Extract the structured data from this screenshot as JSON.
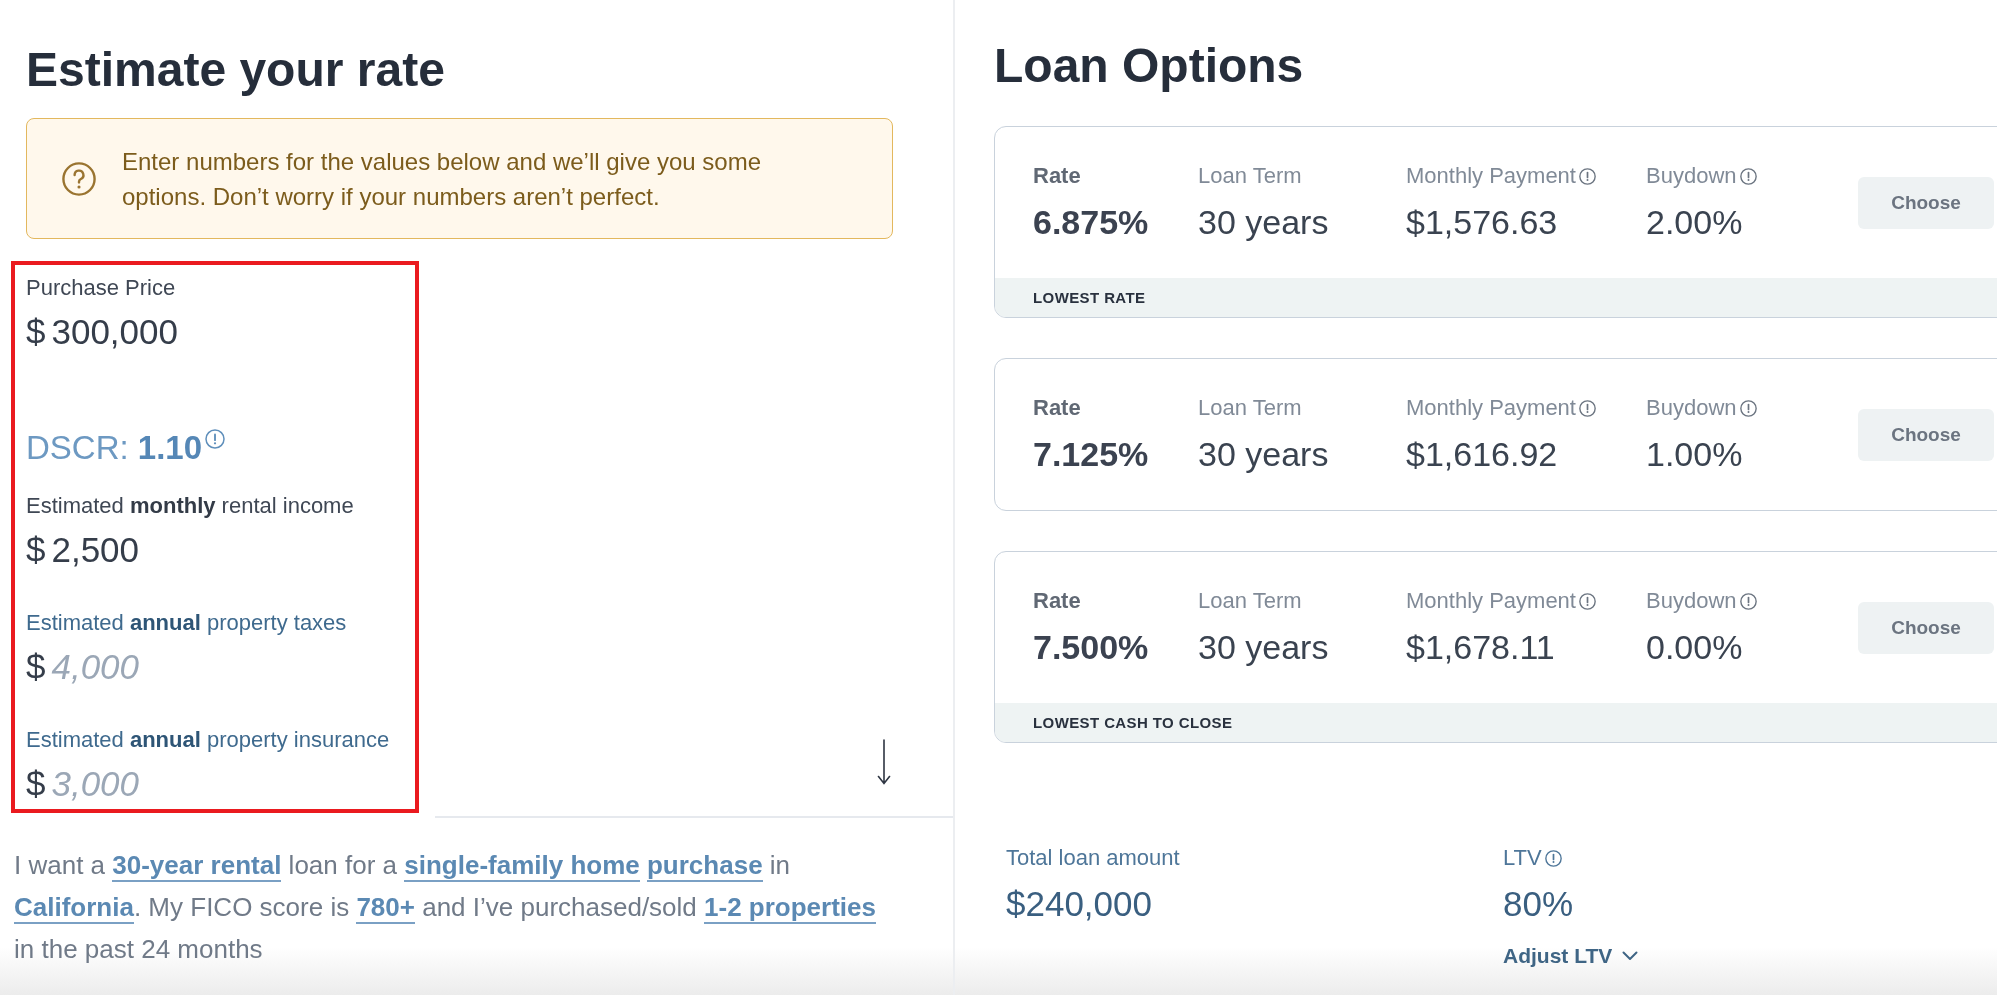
{
  "estimate": {
    "title": "Estimate your rate",
    "notice": "Enter numbers for the values below and we’ll give you some options. Don’t worry if your numbers aren’t perfect.",
    "inputs_highlighted": true,
    "fields": [
      {
        "kind": "amount",
        "label": "Purchase Price",
        "currency": "$",
        "value": "300,000"
      },
      {
        "kind": "ratio",
        "label": "DSCR:",
        "value": "1.10",
        "info": true
      },
      {
        "kind": "amount",
        "label": "Estimated **monthly** rental income",
        "currency": "$",
        "value": "2,500"
      },
      {
        "kind": "amount",
        "label": "Estimated **annual** property taxes",
        "currency": "$",
        "placeholder": "4,000"
      },
      {
        "kind": "amount",
        "label": "Estimated **annual** property insurance",
        "currency": "$",
        "placeholder": "3,000"
      }
    ]
  },
  "loan_preferences": [
    {
      "kind": "text",
      "text": "I want a "
    },
    {
      "kind": "link",
      "text": "30-year rental"
    },
    {
      "kind": "text",
      "text": " loan for a "
    },
    {
      "kind": "link",
      "text": "single-family home"
    },
    {
      "kind": "link",
      "text": "purchase"
    },
    {
      "kind": "text",
      "text": " in "
    },
    {
      "kind": "link",
      "text": "California"
    },
    {
      "kind": "text",
      "text": ". My FICO score is "
    },
    {
      "kind": "link",
      "text": "780+"
    },
    {
      "kind": "text",
      "text": " and I’ve purchased/sold "
    },
    {
      "kind": "link",
      "text": "1-2 properties"
    },
    {
      "kind": "text",
      "text": " in the past 24 months"
    }
  ],
  "loan_options": {
    "title": "Loan Options",
    "options": [
      {
        "stats": [
          {
            "kind": "rate",
            "label": "Rate",
            "value": "6.875%",
            "info": false
          },
          {
            "kind": "detail",
            "label": "Loan Term",
            "value": "30 years",
            "info": false
          },
          {
            "kind": "detail",
            "label": "Monthly Payment",
            "value": "$1,576.63",
            "info": true
          },
          {
            "kind": "detail",
            "label": "Buydown",
            "value": "2.00%",
            "info": true
          }
        ],
        "button": "Choose",
        "tag": "LOWEST RATE"
      },
      {
        "stats": [
          {
            "kind": "rate",
            "label": "Rate",
            "value": "7.125%",
            "info": false
          },
          {
            "kind": "detail",
            "label": "Loan Term",
            "value": "30 years",
            "info": false
          },
          {
            "kind": "detail",
            "label": "Monthly Payment",
            "value": "$1,616.92",
            "info": true
          },
          {
            "kind": "detail",
            "label": "Buydown",
            "value": "1.00%",
            "info": true
          }
        ],
        "button": "Choose"
      },
      {
        "stats": [
          {
            "kind": "rate",
            "label": "Rate",
            "value": "7.500%",
            "info": false
          },
          {
            "kind": "detail",
            "label": "Loan Term",
            "value": "30 years",
            "info": false
          },
          {
            "kind": "detail",
            "label": "Monthly Payment",
            "value": "$1,678.11",
            "info": true
          },
          {
            "kind": "detail",
            "label": "Buydown",
            "value": "0.00%",
            "info": true
          }
        ],
        "button": "Choose",
        "tag": "LOWEST CASH TO CLOSE"
      }
    ]
  },
  "loan_summary": [
    {
      "label": "Total loan amount",
      "value": "$240,000",
      "info": false
    },
    {
      "label": "LTV",
      "value": "80%",
      "info": true,
      "action": "Adjust LTV"
    }
  ]
}
